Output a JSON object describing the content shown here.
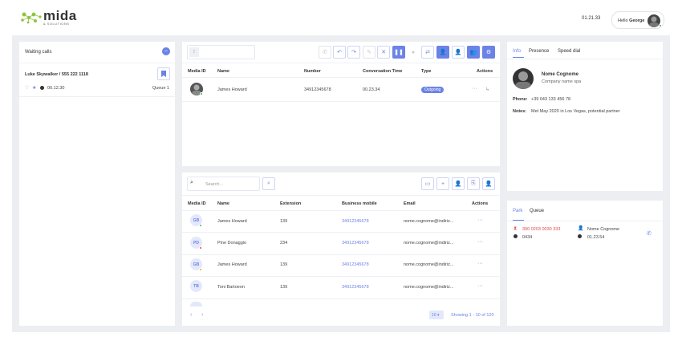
{
  "header": {
    "logo_name": "mida",
    "logo_sub": "& SOLUTIONS",
    "clock": "01.21.33",
    "greeting": "Hello",
    "user": "George"
  },
  "waiting": {
    "title": "Waiting calls",
    "count_icon": "minus-icon",
    "caller": "Luke Skywalker / 555 222 1118",
    "time": "00.12.30",
    "queue": "Queue 1"
  },
  "calls": {
    "columns": [
      "Media ID",
      "Name",
      "Number",
      "Conversation Time",
      "Type",
      "Actions"
    ],
    "rows": [
      {
        "name": "James Howard",
        "number": "34912345678",
        "time": "00.23.34",
        "type": "Outgoing"
      }
    ]
  },
  "contacts": {
    "search_placeholder": "Search...",
    "columns": [
      "Media ID",
      "Name",
      "Extension",
      "Business mobile",
      "Email",
      "Actions"
    ],
    "rows": [
      {
        "initials": "GB",
        "name": "James Howard",
        "extension": "139",
        "mobile": "34912345678",
        "email": "nome.cognome@indiriz...",
        "status": "#3bb54a"
      },
      {
        "initials": "PD",
        "name": "Pine Donaggio",
        "extension": "234",
        "mobile": "34912345678",
        "email": "nome.cognome@indiriz...",
        "status": "#e04848"
      },
      {
        "initials": "GB",
        "name": "James Howard",
        "extension": "139",
        "mobile": "34912345678",
        "email": "nome.cognome@indiriz...",
        "status": "#f0a530"
      },
      {
        "initials": "TB",
        "name": "Toni Bartoeon",
        "extension": "139",
        "mobile": "34912345678",
        "email": "nome.cognome@indiriz...",
        "status": "#9aa0ab"
      }
    ],
    "page_size": "10",
    "showing": "Showing 1 - 10 of 120"
  },
  "info": {
    "tabs": [
      "Info",
      "Presence",
      "Speed dial"
    ],
    "name": "Nome Cognome",
    "company": "Company name spa",
    "phone_label": "Phone:",
    "phone": "+39 043 133 456 78",
    "notes_label": "Notes:",
    "notes": "Met May 2020 in Los Vegas, potential partner"
  },
  "park": {
    "tabs": [
      "Park",
      "Queue"
    ],
    "number": "390 0203 0030 333",
    "code": "0434",
    "contact": "Nome Cognome",
    "time": "01.23.54"
  }
}
